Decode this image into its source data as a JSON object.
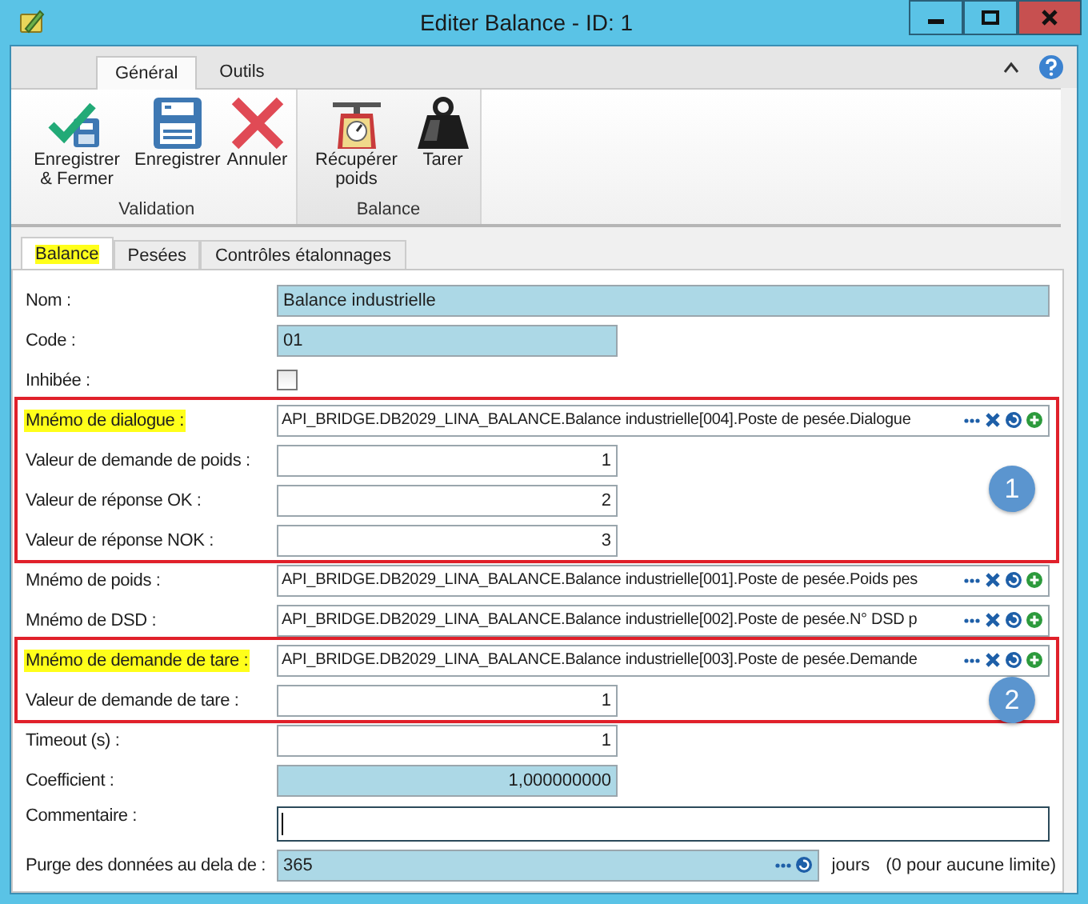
{
  "window": {
    "title": "Editer Balance - ID: 1"
  },
  "ribbon": {
    "tabs": [
      {
        "label": "Général",
        "selected": true
      },
      {
        "label": "Outils",
        "selected": false
      }
    ],
    "groups": [
      {
        "label": "Validation",
        "buttons": [
          {
            "label": "Enregistrer & Fermer",
            "kind": "save-close"
          },
          {
            "label": "Enregistrer",
            "kind": "save"
          },
          {
            "label": "Annuler",
            "kind": "cancel"
          }
        ]
      },
      {
        "label": "Balance",
        "buttons": [
          {
            "label": "Récupérer poids",
            "kind": "scale"
          },
          {
            "label": "Tarer",
            "kind": "weight"
          }
        ]
      }
    ]
  },
  "subtabs": [
    {
      "label": "Balance",
      "selected": true,
      "highlighted": true
    },
    {
      "label": "Pesées",
      "selected": false,
      "highlighted": false
    },
    {
      "label": "Contrôles étalonnages",
      "selected": false,
      "highlighted": false
    }
  ],
  "form": {
    "sections": [
      {
        "rows": [
          {
            "label": "Nom :",
            "highlighted": false,
            "kind": "text",
            "readonly": true,
            "value": "Balance industrielle"
          },
          {
            "label": "Code :",
            "highlighted": false,
            "kind": "short-text",
            "readonly": true,
            "value": "01"
          },
          {
            "label": "Inhibée :",
            "highlighted": false,
            "kind": "checkbox",
            "checked": false
          }
        ]
      },
      {
        "outlined": true,
        "badge": "1",
        "rows": [
          {
            "label": "Mnémo de dialogue :",
            "highlighted": true,
            "kind": "mnemo",
            "value": "API_BRIDGE.DB2029_LINA_BALANCE.Balance industrielle[004].Poste de pesée.Dialogue"
          },
          {
            "label": "Valeur de demande de poids :",
            "highlighted": false,
            "kind": "number",
            "readonly": false,
            "value": "1"
          },
          {
            "label": "Valeur de réponse OK :",
            "highlighted": false,
            "kind": "number",
            "readonly": false,
            "value": "2"
          },
          {
            "label": "Valeur de réponse NOK :",
            "highlighted": false,
            "kind": "number",
            "readonly": false,
            "value": "3"
          }
        ]
      },
      {
        "rows": [
          {
            "label": "Mnémo de poids :",
            "highlighted": false,
            "kind": "mnemo",
            "value": "API_BRIDGE.DB2029_LINA_BALANCE.Balance industrielle[001].Poste de pesée.Poids pes"
          },
          {
            "label": "Mnémo de DSD :",
            "highlighted": false,
            "kind": "mnemo",
            "value": "API_BRIDGE.DB2029_LINA_BALANCE.Balance industrielle[002].Poste de pesée.N° DSD p"
          }
        ]
      },
      {
        "outlined": true,
        "badge": "2",
        "rows": [
          {
            "label": "Mnémo de demande de tare :",
            "highlighted": true,
            "kind": "mnemo",
            "value": "API_BRIDGE.DB2029_LINA_BALANCE.Balance industrielle[003].Poste de pesée.Demande"
          },
          {
            "label": "Valeur de demande de tare :",
            "highlighted": false,
            "kind": "number",
            "readonly": false,
            "value": "1"
          }
        ]
      },
      {
        "rows": [
          {
            "label": "Timeout (s) :",
            "highlighted": false,
            "kind": "number",
            "readonly": false,
            "value": "1"
          },
          {
            "label": "Coefficient :",
            "highlighted": false,
            "kind": "number",
            "readonly": true,
            "value": "1,000000000"
          },
          {
            "label": "Commentaire :",
            "highlighted": false,
            "kind": "memo",
            "focused": true
          },
          {
            "label": "Purge des données au dela de :",
            "highlighted": false,
            "kind": "purge",
            "readonly": true,
            "value": "365",
            "unit": "jours",
            "note": "(0 pour aucune limite)"
          }
        ]
      }
    ]
  }
}
